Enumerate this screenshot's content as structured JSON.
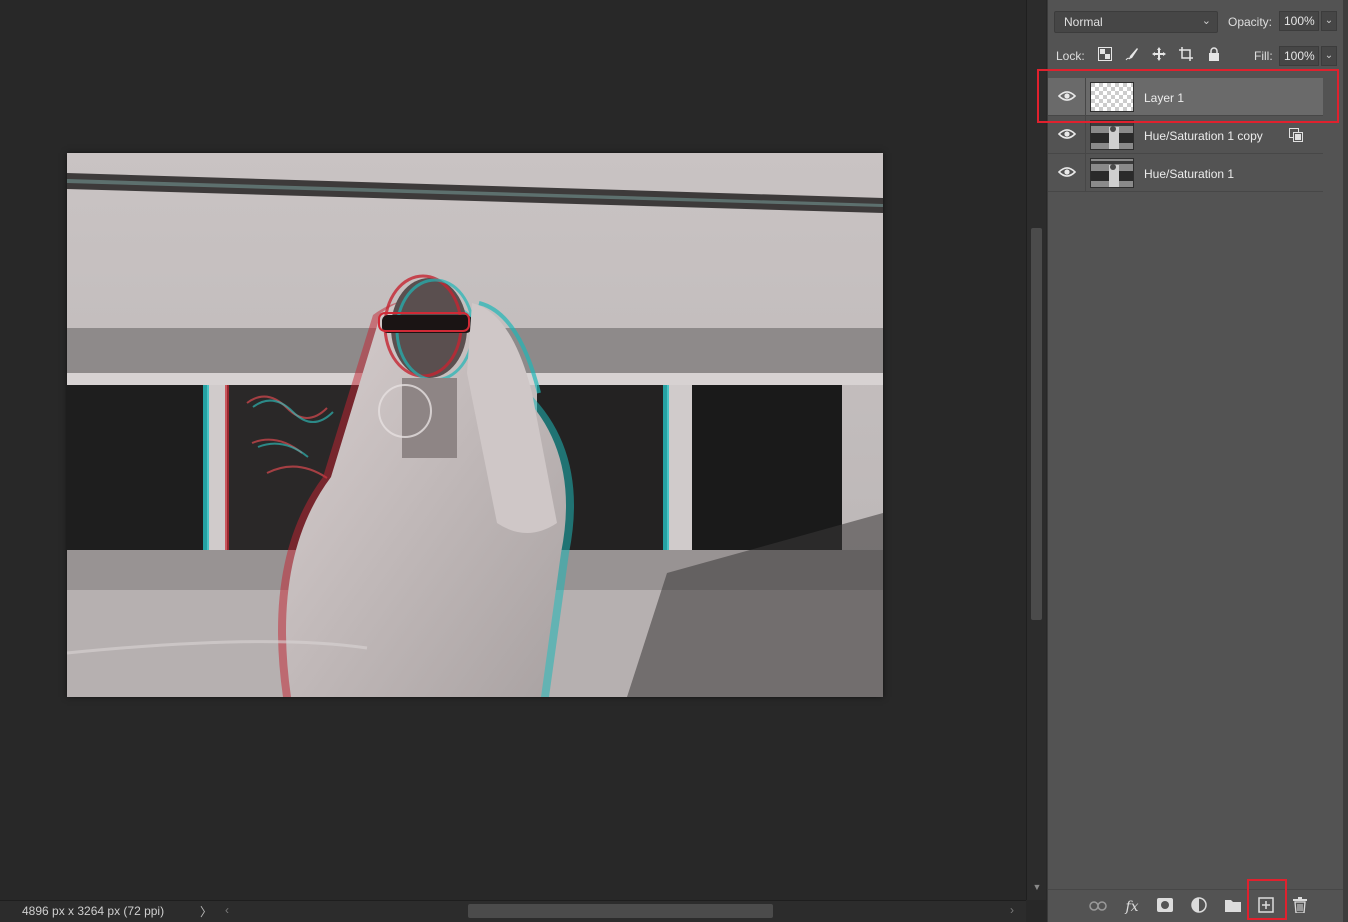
{
  "status_bar": {
    "doc_info": "4896 px x 3264 px (72 ppi)",
    "arrow": "〉",
    "scroll_left": "‹",
    "scroll_right": "›"
  },
  "layers_panel": {
    "blend_mode": "Normal",
    "opacity_label": "Opacity:",
    "opacity_value": "100%",
    "lock_label": "Lock:",
    "fill_label": "Fill:",
    "fill_value": "100%",
    "layers": [
      {
        "name": "Layer 1",
        "selected": true,
        "visible": true,
        "thumbnail": "transparent-checker"
      },
      {
        "name": "Hue/Saturation 1 copy",
        "selected": false,
        "visible": true,
        "thumbnail": "photo-grayscale",
        "linked_icon": "smart-object-icon"
      },
      {
        "name": "Hue/Saturation 1",
        "selected": false,
        "visible": true,
        "thumbnail": "photo-grayscale"
      }
    ],
    "footer_icons": [
      "link-layers-icon",
      "fx-icon",
      "add-mask-icon",
      "adjustment-layer-icon",
      "group-folder-icon",
      "new-layer-icon",
      "delete-layer-icon"
    ]
  },
  "colors": {
    "highlight": "#e0212e",
    "panel_bg": "#535353",
    "canvas_bg": "#282828",
    "selected_row": "#6a6a6a"
  }
}
